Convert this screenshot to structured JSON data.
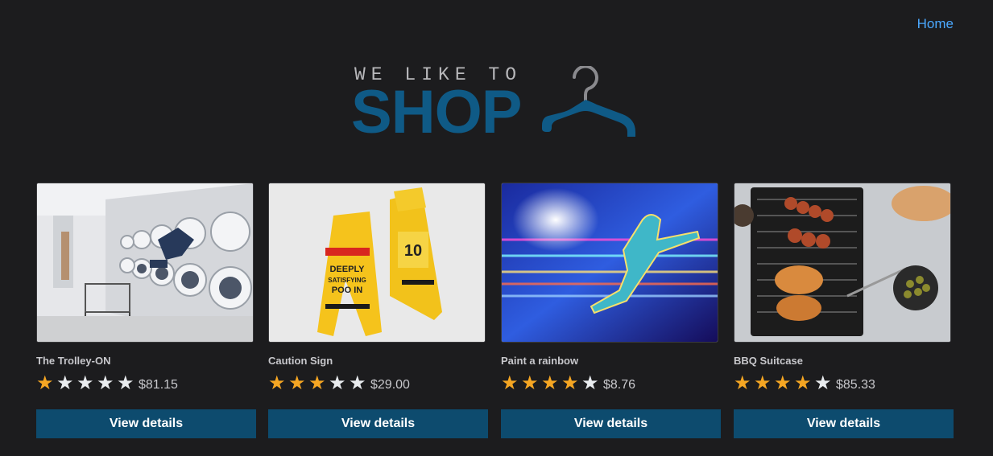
{
  "nav": {
    "home_label": "Home"
  },
  "logo": {
    "tagline": "WE LIKE TO",
    "wordmark": "SHOP",
    "icon": "hanger-icon"
  },
  "colors": {
    "background": "#1c1c1e",
    "accent": "#0d4b6e",
    "link": "#4aa8ff",
    "star_on": "#f5a623",
    "star_off": "#e9ecef"
  },
  "products": [
    {
      "name": "The Trolley-ON",
      "rating": 1,
      "max_rating": 5,
      "price": "$81.15",
      "button_label": "View details",
      "image": "laundromat-photo"
    },
    {
      "name": "Caution Sign",
      "rating": 3,
      "max_rating": 5,
      "price": "$29.00",
      "button_label": "View details",
      "image": "caution-sign-photo"
    },
    {
      "name": "Paint a rainbow",
      "rating": 4,
      "max_rating": 5,
      "price": "$8.76",
      "button_label": "View details",
      "image": "neon-runner-photo"
    },
    {
      "name": "BBQ Suitcase",
      "rating": 4,
      "max_rating": 5,
      "price": "$85.33",
      "button_label": "View details",
      "image": "bbq-grill-photo"
    }
  ]
}
